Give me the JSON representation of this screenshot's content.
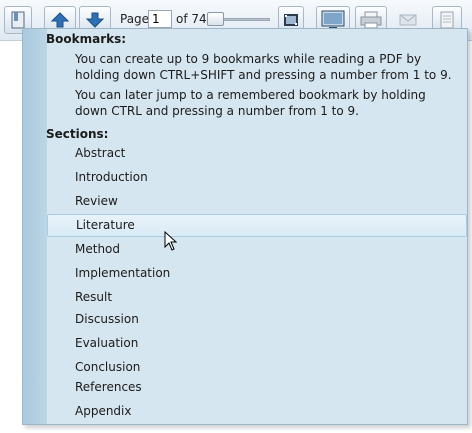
{
  "toolbar": {
    "page_label": "Page:",
    "page_value": "1",
    "of_label": "of 74",
    "icons": [
      "bookmark-icon",
      "up-arrow-icon",
      "down-arrow-icon",
      "film-icon",
      "monitor-icon",
      "printer-icon",
      "mail-icon",
      "document-icon"
    ]
  },
  "popup": {
    "bookmarks_heading": "Bookmarks:",
    "bookmarks_text_1": "You can create up to 9 bookmarks while reading a PDF by holding down CTRL+SHIFT and pressing a number from 1 to 9.",
    "bookmarks_text_2": "You can later jump to a remembered bookmark by holding down CTRL and pressing a number from 1 to 9.",
    "sections_heading": "Sections:",
    "sections": [
      "Abstract",
      "Introduction",
      "Review",
      "Literature",
      "Method",
      "Implementation",
      "Result",
      "Discussion",
      "Evaluation",
      "Conclusion",
      "References",
      "Appendix"
    ],
    "highlighted_section": "Literature"
  },
  "colors": {
    "popup_background": "#d6e6f1",
    "highlight": "#e3eff8",
    "accent_blue": "#2f6fb5"
  }
}
